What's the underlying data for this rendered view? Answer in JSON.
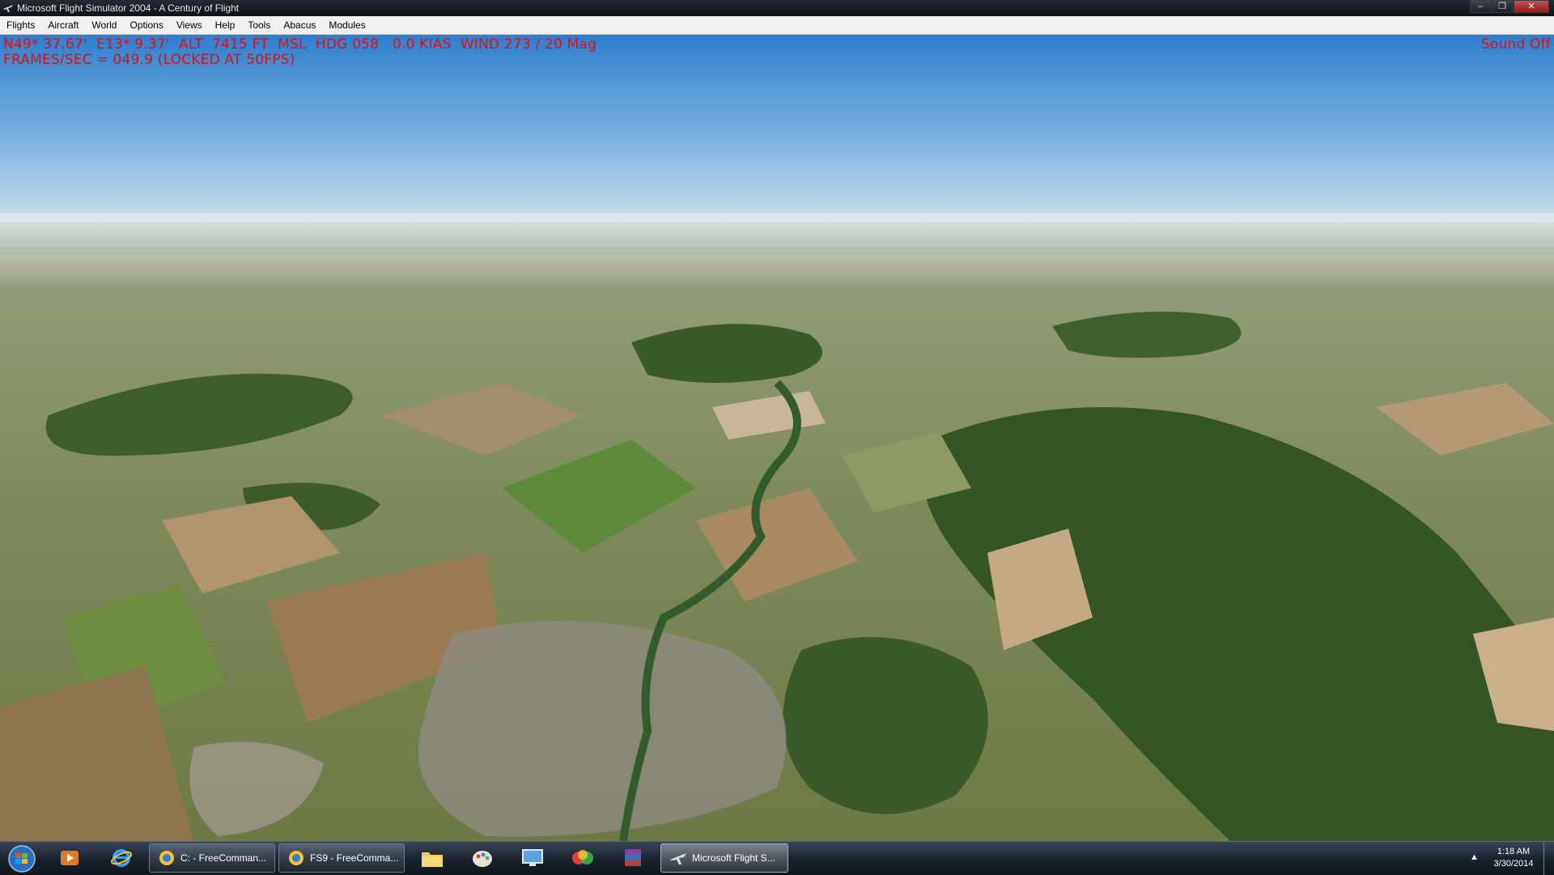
{
  "window": {
    "title": "Microsoft Flight Simulator 2004 - A Century of Flight",
    "icon": "airplane-icon",
    "controls": [
      "minimize-icon",
      "restore-icon",
      "close-icon"
    ]
  },
  "menu": {
    "items": [
      "Flights",
      "Aircraft",
      "World",
      "Options",
      "Views",
      "Help",
      "Tools",
      "Abacus",
      "Modules"
    ]
  },
  "hud": {
    "line1": "N49* 37.67'  E13* 9.37'  ALT  7415 FT  MSL  HDG 058   0.0 KIAS  WIND 273 / 20 Mag",
    "line2": "FRAMES/SEC = 049.9 (LOCKED AT 50FPS)",
    "sound": "Sound Off",
    "color": "#e01010"
  },
  "taskbar": {
    "start_icon": "windows-start-icon",
    "pinned": [
      "media-player-icon",
      "internet-explorer-icon"
    ],
    "buttons": [
      {
        "label": "C: - FreeComman...",
        "icon": "freecommander-icon"
      },
      {
        "label": "FS9 - FreeComma...",
        "icon": "freecommander-icon"
      }
    ],
    "pinned2": [
      "file-explorer-icon",
      "paint-icon",
      "remote-desktop-icon",
      "colorful-app-icon",
      "winrar-icon"
    ],
    "active_button": {
      "label": "Microsoft Flight S...",
      "icon": "airplane-icon"
    },
    "clock": {
      "time": "1:18 AM",
      "date": "3/30/2014"
    }
  }
}
